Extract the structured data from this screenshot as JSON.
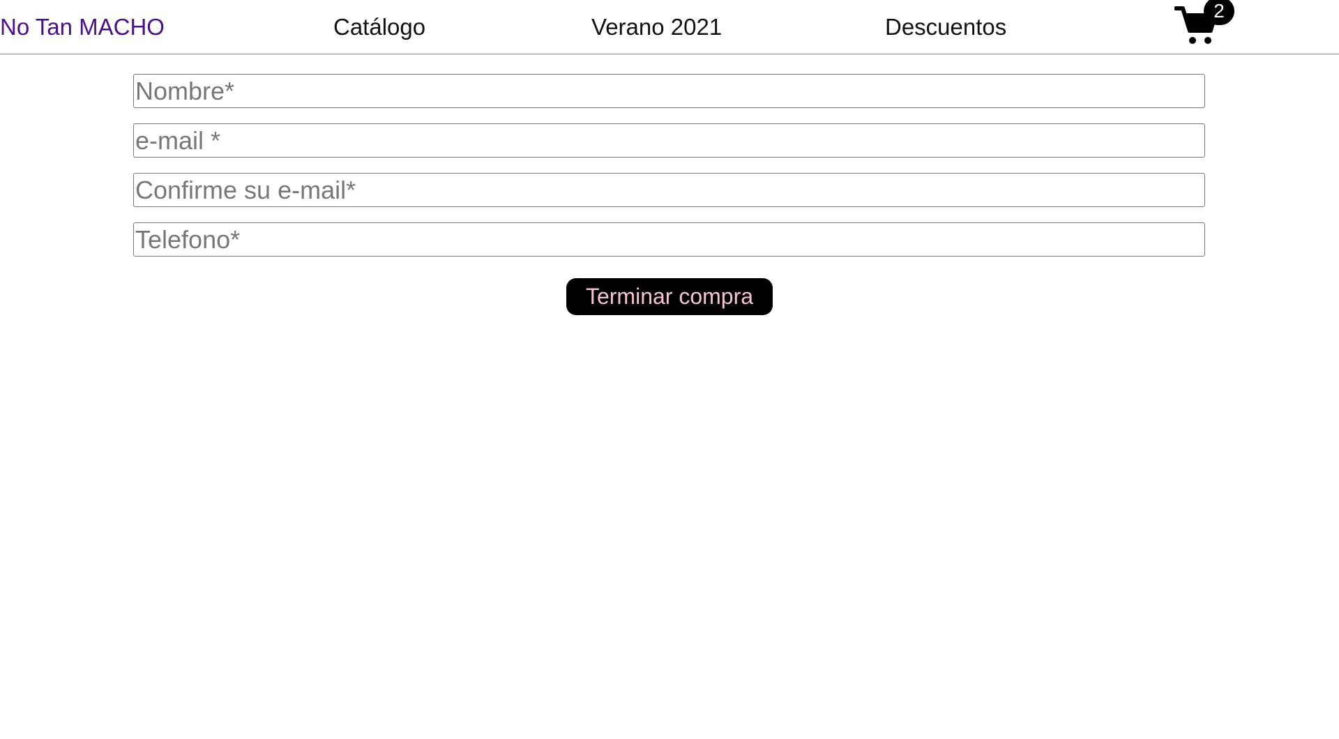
{
  "nav": {
    "brand": "No Tan MACHO",
    "links": [
      {
        "label": "Catálogo"
      },
      {
        "label": "Verano 2021"
      },
      {
        "label": "Descuentos"
      }
    ],
    "cart": {
      "icon": "cart-icon",
      "count": "2"
    }
  },
  "form": {
    "fields": [
      {
        "placeholder": "Nombre*"
      },
      {
        "placeholder": "e-mail *"
      },
      {
        "placeholder": "Confirme su e-mail*"
      },
      {
        "placeholder": "Telefono*"
      }
    ],
    "submit_label": "Terminar compra"
  },
  "colors": {
    "brand": "#4b0f8a",
    "button_bg": "#000000",
    "button_text": "#f6c3d2"
  }
}
